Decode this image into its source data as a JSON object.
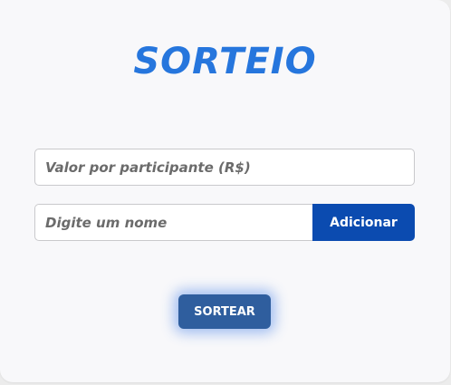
{
  "header": {
    "title": "SORTEIO"
  },
  "form": {
    "valor_placeholder": "Valor por participante (R$)",
    "valor_value": "",
    "name_placeholder": "Digite um nome",
    "name_value": "",
    "add_label": "Adicionar",
    "draw_label": "SORTEAR"
  },
  "colors": {
    "title": "#2676dd",
    "add_button": "#0b4bb0",
    "draw_button": "#2f5e9e",
    "card_background": "#f8f8fa"
  }
}
